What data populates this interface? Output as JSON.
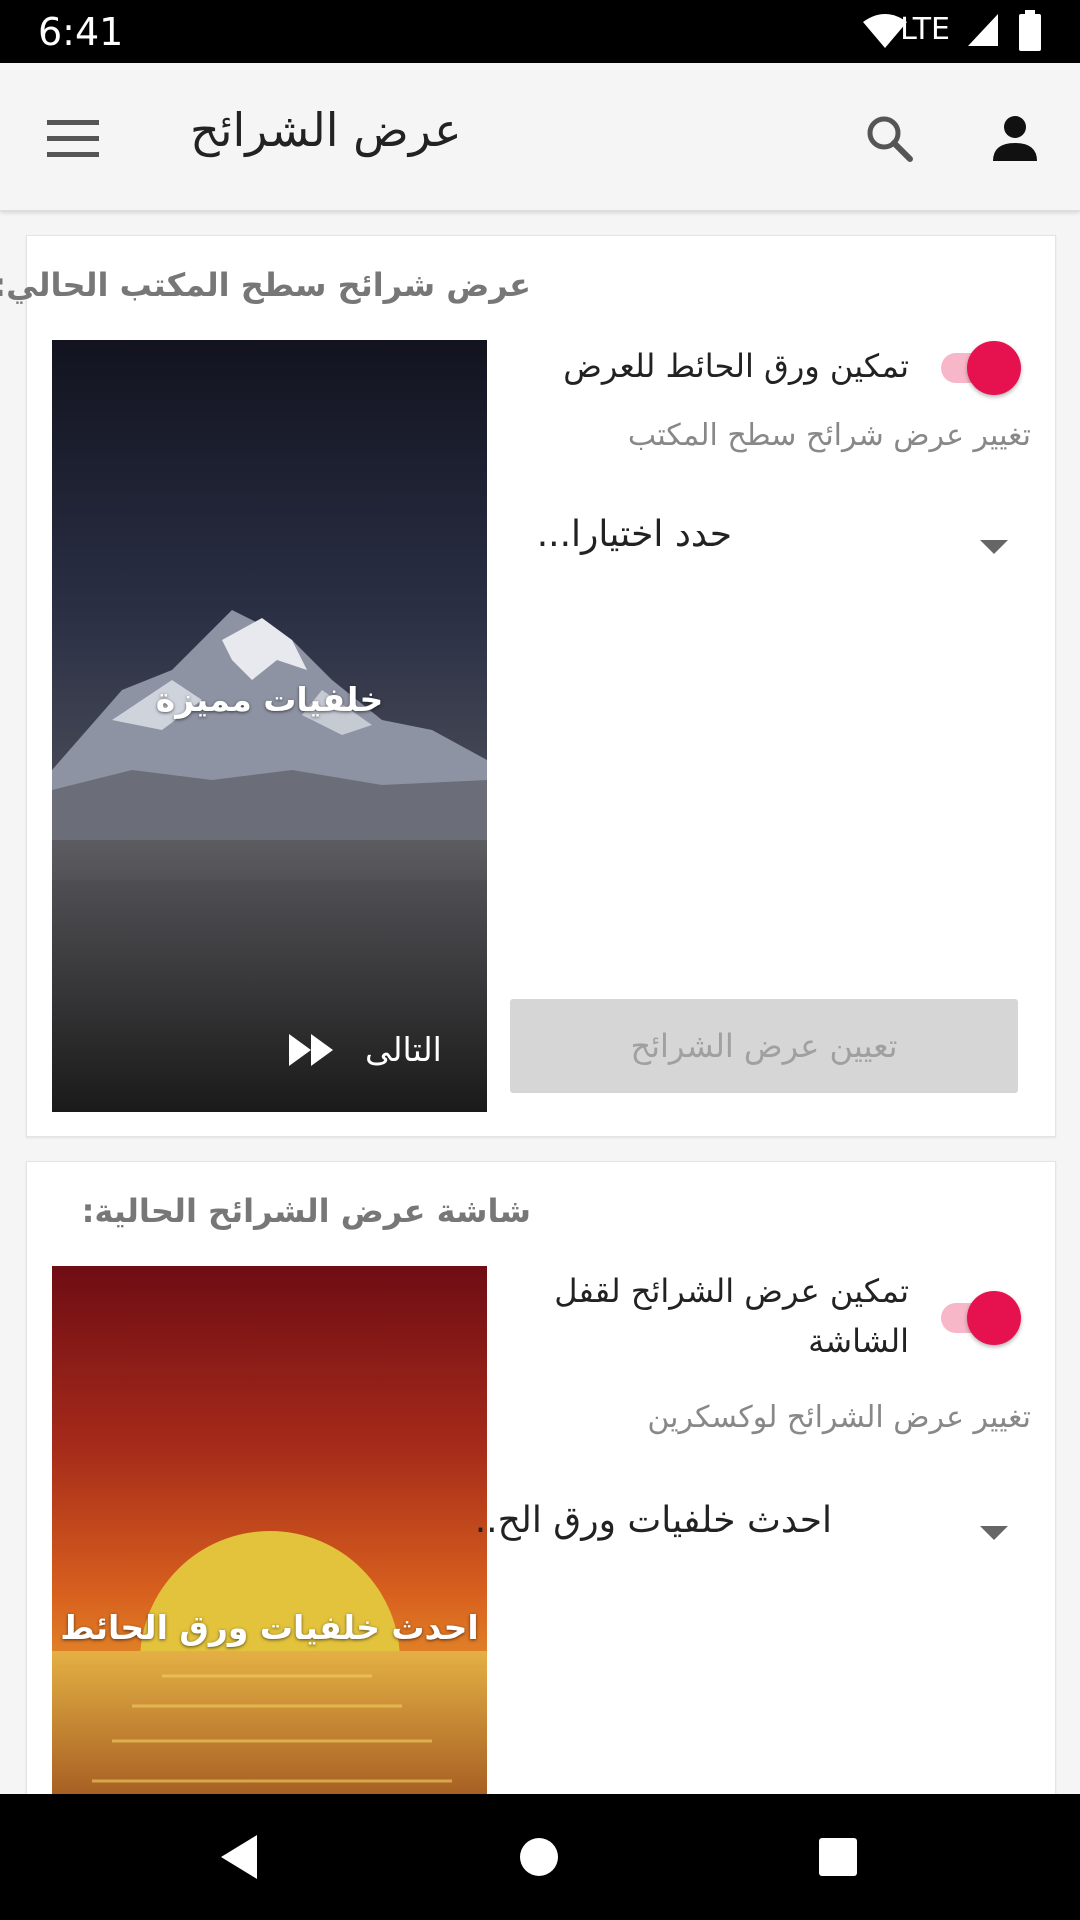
{
  "status_bar": {
    "time": "6:41",
    "network": "LTE"
  },
  "app_bar": {
    "title": "عرض الشرائح"
  },
  "desktop_card": {
    "heading": "عرض شرائح سطح المكتب الحالي:",
    "preview_label": "خلفيات مميزة",
    "next_label": "التالى",
    "toggle_label": "تمكين ورق الحائط للعرض",
    "toggle_on": true,
    "subtext": "تغيير عرض شرائح سطح المكتب",
    "dropdown_value": "حدد اختيارا...",
    "set_button": "تعيين عرض الشرائح"
  },
  "lock_card": {
    "heading": "شاشة عرض الشرائح الحالية:",
    "preview_label": "احدث خلفيات ورق الحائط",
    "toggle_label_line1": "تمكين عرض الشرائح لقفل",
    "toggle_label_line2": "الشاشة",
    "toggle_on": true,
    "subtext": "تغيير عرض الشرائح لوكسكرين",
    "dropdown_value": "احدث خلفيات ورق الح.."
  },
  "colors": {
    "accent": "#e6124f",
    "track": "#f7b7c9"
  }
}
